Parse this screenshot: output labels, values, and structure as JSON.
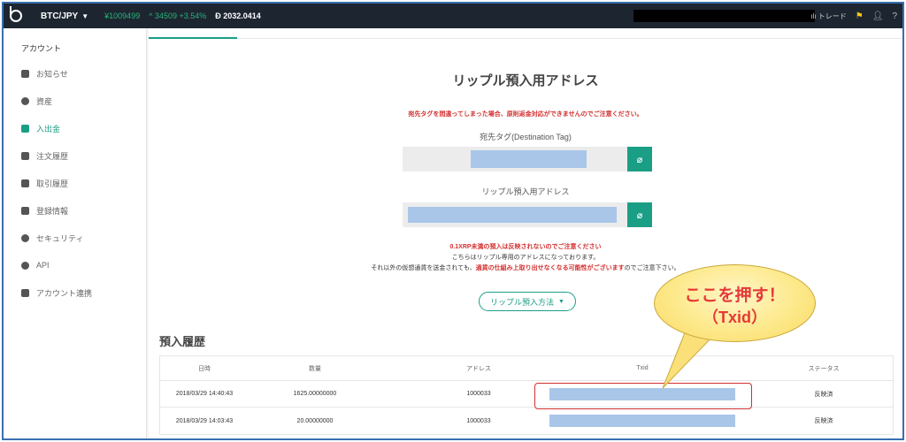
{
  "topbar": {
    "pair": "BTC/JPY",
    "price": "¥1009499",
    "change": "^ 34509 +3.54%",
    "ref_price": "Ɖ 2032.0414",
    "trade_label": "トレード"
  },
  "sidebar": {
    "title": "アカウント",
    "items": [
      {
        "label": "お知らせ",
        "icon": "message-icon"
      },
      {
        "label": "資産",
        "icon": "asset-icon"
      },
      {
        "label": "入出金",
        "icon": "bank-icon",
        "active": true
      },
      {
        "label": "注文履歴",
        "icon": "clipboard-icon"
      },
      {
        "label": "取引履歴",
        "icon": "document-icon"
      },
      {
        "label": "登録情報",
        "icon": "id-card-icon"
      },
      {
        "label": "セキュリティ",
        "icon": "shield-icon"
      },
      {
        "label": "API",
        "icon": "gear-icon"
      },
      {
        "label": "アカウント連携",
        "icon": "people-icon"
      }
    ]
  },
  "main": {
    "title": "リップル預入用アドレス",
    "warning": "宛先タグを間違ってしまった場合、原則返金対応ができませんのでご注意ください。",
    "tag_label": "宛先タグ(Destination Tag)",
    "address_label": "リップル預入用アドレス",
    "note_min": "0.1XRP未満の預入は反映されないのでご注意ください",
    "note_only": "こちらはリップル専用のアドレスになっております。",
    "note_other_pre": "それ以外の仮想通貨を送金されても、",
    "note_other_red": "通貨の仕組み上取り出せなくなる可能性がございます",
    "note_other_post": "のでご注意下さい。",
    "method_button": "リップル預入方法",
    "history_title": "預入履歴",
    "columns": [
      "日時",
      "数量",
      "アドレス",
      "Txid",
      "ステータス"
    ],
    "rows": [
      {
        "date": "2018/03/29 14:40:43",
        "qty": "1625.00000000",
        "address": "1000033",
        "status": "反映済"
      },
      {
        "date": "2018/03/29 14:03:43",
        "qty": "20.00000000",
        "address": "1000033",
        "status": "反映済"
      }
    ]
  },
  "callout": {
    "line1": "ここを押す！",
    "line2": "（Txid）"
  },
  "colors": {
    "accent": "#1a9e86",
    "warning": "#d32f2f",
    "redacted": "#a9c6e8",
    "topbar": "#1d2630"
  }
}
